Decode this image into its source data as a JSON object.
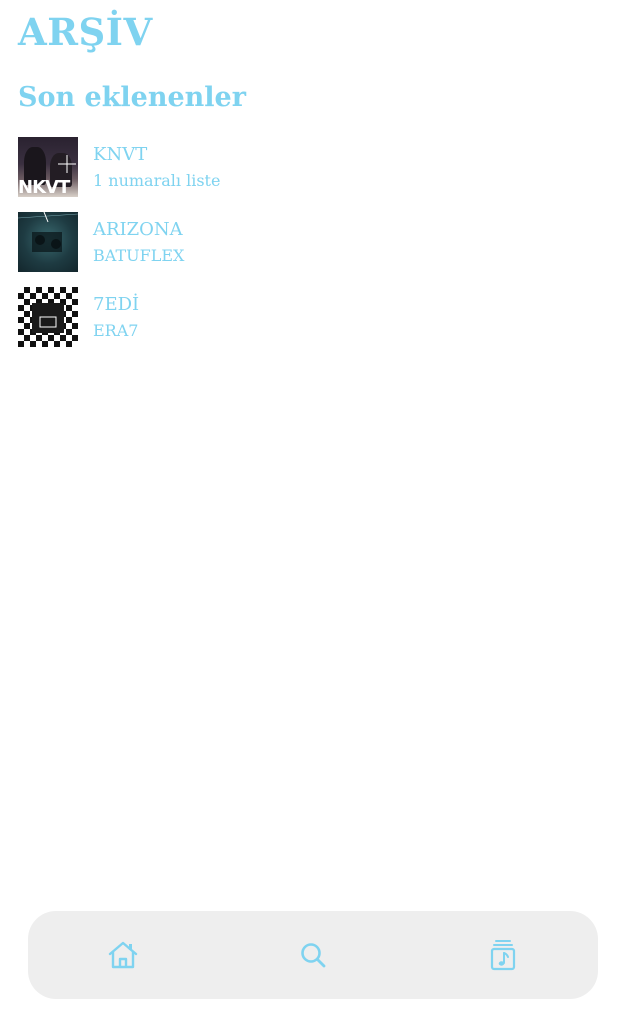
{
  "header": {
    "title": "ARŞİV"
  },
  "recent": {
    "heading": "Son eklenenler",
    "items": [
      {
        "title": "KNVT",
        "subtitle": "1 numaralı liste",
        "cover_text": "NKVT"
      },
      {
        "title": "ARIZONA",
        "subtitle": "BATUFLEX"
      },
      {
        "title": "7EDİ",
        "subtitle": "ERA7"
      }
    ]
  },
  "nav": {
    "items": [
      {
        "icon": "home-icon"
      },
      {
        "icon": "search-icon"
      },
      {
        "icon": "music-library-icon"
      }
    ],
    "background": "#eeeeee",
    "icon_color": "#7fd3f0"
  },
  "colors": {
    "accent": "#7fd3f0",
    "background": "#ffffff"
  }
}
